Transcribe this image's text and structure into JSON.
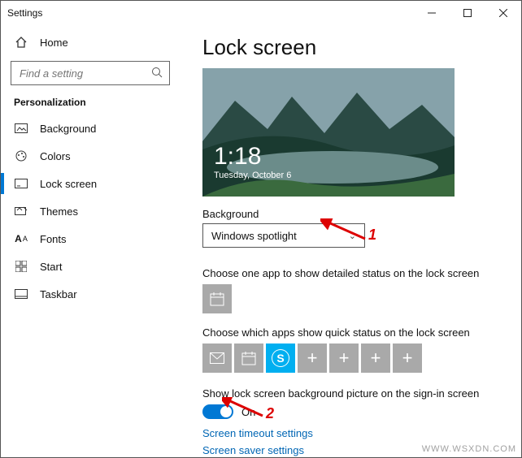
{
  "window": {
    "title": "Settings"
  },
  "sidebar": {
    "home": "Home",
    "search_placeholder": "Find a setting",
    "section": "Personalization",
    "items": [
      {
        "label": "Background"
      },
      {
        "label": "Colors"
      },
      {
        "label": "Lock screen"
      },
      {
        "label": "Themes"
      },
      {
        "label": "Fonts"
      },
      {
        "label": "Start"
      },
      {
        "label": "Taskbar"
      }
    ]
  },
  "page": {
    "title": "Lock screen",
    "preview_time": "1:18",
    "preview_date": "Tuesday, October 6",
    "background_label": "Background",
    "background_value": "Windows spotlight",
    "detailed_label": "Choose one app to show detailed status on the lock screen",
    "quick_label": "Choose which apps show quick status on the lock screen",
    "signin_label": "Show lock screen background picture on the sign-in screen",
    "toggle_state": "On",
    "link_timeout": "Screen timeout settings",
    "link_saver": "Screen saver settings"
  },
  "annotations": {
    "one": "1",
    "two": "2"
  },
  "watermark": "WWW.WSXDN.COM"
}
